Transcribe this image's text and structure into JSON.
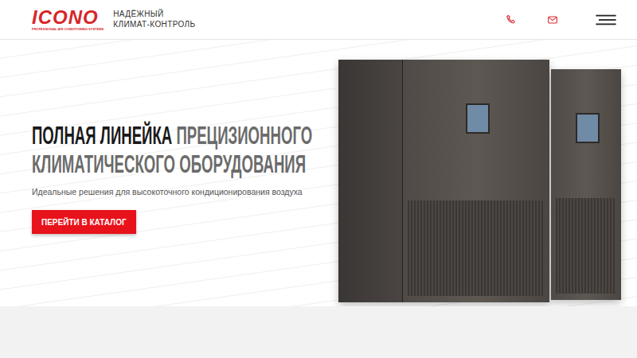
{
  "header": {
    "logo": {
      "name": "ICONO",
      "subtitle": "PROFESSIONAL AIR CONDITIONING SYSTEMS"
    },
    "tagline": [
      "НАДЁЖНЫЙ",
      "КЛИМАТ-КОНТРОЛЬ"
    ]
  },
  "hero": {
    "heading": [
      [
        {
          "text": "ПОЛНАЯ ЛИНЕЙКА",
          "emphasis": true
        },
        {
          "text": "ПРЕЦИЗИОННОГО",
          "emphasis": false
        }
      ],
      [
        {
          "text": "КЛИМАТИЧЕСКОГО ОБОРУДОВАНИЯ",
          "emphasis": false
        }
      ]
    ],
    "subtitle": "Идеальные решения для высокоточного кондиционирования воздуха",
    "button": "ПЕРЕЙТИ В КАТАЛОГ"
  }
}
